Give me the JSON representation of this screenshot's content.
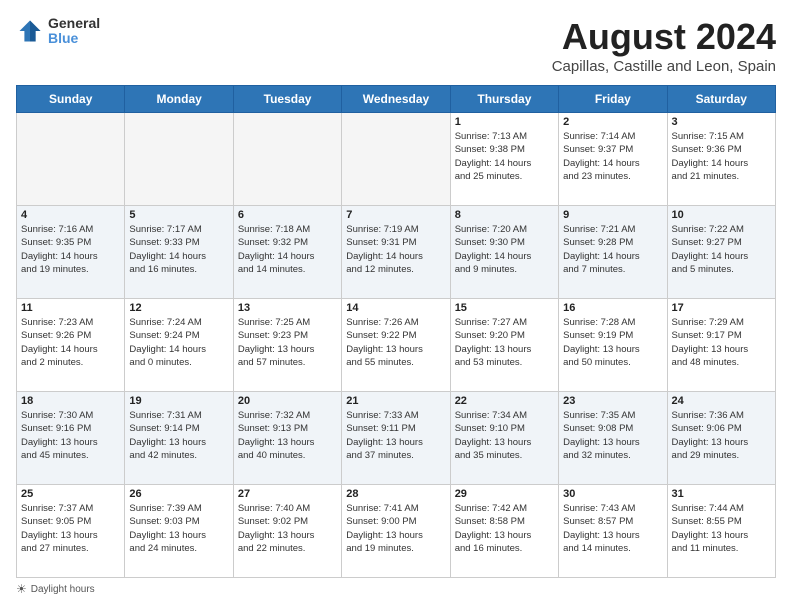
{
  "header": {
    "logo_line1": "General",
    "logo_line2": "Blue",
    "title": "August 2024",
    "subtitle": "Capillas, Castille and Leon, Spain"
  },
  "weekdays": [
    "Sunday",
    "Monday",
    "Tuesday",
    "Wednesday",
    "Thursday",
    "Friday",
    "Saturday"
  ],
  "footer": {
    "daylight_label": "Daylight hours"
  },
  "weeks": [
    [
      {
        "day": "",
        "info": ""
      },
      {
        "day": "",
        "info": ""
      },
      {
        "day": "",
        "info": ""
      },
      {
        "day": "",
        "info": ""
      },
      {
        "day": "1",
        "info": "Sunrise: 7:13 AM\nSunset: 9:38 PM\nDaylight: 14 hours\nand 25 minutes."
      },
      {
        "day": "2",
        "info": "Sunrise: 7:14 AM\nSunset: 9:37 PM\nDaylight: 14 hours\nand 23 minutes."
      },
      {
        "day": "3",
        "info": "Sunrise: 7:15 AM\nSunset: 9:36 PM\nDaylight: 14 hours\nand 21 minutes."
      }
    ],
    [
      {
        "day": "4",
        "info": "Sunrise: 7:16 AM\nSunset: 9:35 PM\nDaylight: 14 hours\nand 19 minutes."
      },
      {
        "day": "5",
        "info": "Sunrise: 7:17 AM\nSunset: 9:33 PM\nDaylight: 14 hours\nand 16 minutes."
      },
      {
        "day": "6",
        "info": "Sunrise: 7:18 AM\nSunset: 9:32 PM\nDaylight: 14 hours\nand 14 minutes."
      },
      {
        "day": "7",
        "info": "Sunrise: 7:19 AM\nSunset: 9:31 PM\nDaylight: 14 hours\nand 12 minutes."
      },
      {
        "day": "8",
        "info": "Sunrise: 7:20 AM\nSunset: 9:30 PM\nDaylight: 14 hours\nand 9 minutes."
      },
      {
        "day": "9",
        "info": "Sunrise: 7:21 AM\nSunset: 9:28 PM\nDaylight: 14 hours\nand 7 minutes."
      },
      {
        "day": "10",
        "info": "Sunrise: 7:22 AM\nSunset: 9:27 PM\nDaylight: 14 hours\nand 5 minutes."
      }
    ],
    [
      {
        "day": "11",
        "info": "Sunrise: 7:23 AM\nSunset: 9:26 PM\nDaylight: 14 hours\nand 2 minutes."
      },
      {
        "day": "12",
        "info": "Sunrise: 7:24 AM\nSunset: 9:24 PM\nDaylight: 14 hours\nand 0 minutes."
      },
      {
        "day": "13",
        "info": "Sunrise: 7:25 AM\nSunset: 9:23 PM\nDaylight: 13 hours\nand 57 minutes."
      },
      {
        "day": "14",
        "info": "Sunrise: 7:26 AM\nSunset: 9:22 PM\nDaylight: 13 hours\nand 55 minutes."
      },
      {
        "day": "15",
        "info": "Sunrise: 7:27 AM\nSunset: 9:20 PM\nDaylight: 13 hours\nand 53 minutes."
      },
      {
        "day": "16",
        "info": "Sunrise: 7:28 AM\nSunset: 9:19 PM\nDaylight: 13 hours\nand 50 minutes."
      },
      {
        "day": "17",
        "info": "Sunrise: 7:29 AM\nSunset: 9:17 PM\nDaylight: 13 hours\nand 48 minutes."
      }
    ],
    [
      {
        "day": "18",
        "info": "Sunrise: 7:30 AM\nSunset: 9:16 PM\nDaylight: 13 hours\nand 45 minutes."
      },
      {
        "day": "19",
        "info": "Sunrise: 7:31 AM\nSunset: 9:14 PM\nDaylight: 13 hours\nand 42 minutes."
      },
      {
        "day": "20",
        "info": "Sunrise: 7:32 AM\nSunset: 9:13 PM\nDaylight: 13 hours\nand 40 minutes."
      },
      {
        "day": "21",
        "info": "Sunrise: 7:33 AM\nSunset: 9:11 PM\nDaylight: 13 hours\nand 37 minutes."
      },
      {
        "day": "22",
        "info": "Sunrise: 7:34 AM\nSunset: 9:10 PM\nDaylight: 13 hours\nand 35 minutes."
      },
      {
        "day": "23",
        "info": "Sunrise: 7:35 AM\nSunset: 9:08 PM\nDaylight: 13 hours\nand 32 minutes."
      },
      {
        "day": "24",
        "info": "Sunrise: 7:36 AM\nSunset: 9:06 PM\nDaylight: 13 hours\nand 29 minutes."
      }
    ],
    [
      {
        "day": "25",
        "info": "Sunrise: 7:37 AM\nSunset: 9:05 PM\nDaylight: 13 hours\nand 27 minutes."
      },
      {
        "day": "26",
        "info": "Sunrise: 7:39 AM\nSunset: 9:03 PM\nDaylight: 13 hours\nand 24 minutes."
      },
      {
        "day": "27",
        "info": "Sunrise: 7:40 AM\nSunset: 9:02 PM\nDaylight: 13 hours\nand 22 minutes."
      },
      {
        "day": "28",
        "info": "Sunrise: 7:41 AM\nSunset: 9:00 PM\nDaylight: 13 hours\nand 19 minutes."
      },
      {
        "day": "29",
        "info": "Sunrise: 7:42 AM\nSunset: 8:58 PM\nDaylight: 13 hours\nand 16 minutes."
      },
      {
        "day": "30",
        "info": "Sunrise: 7:43 AM\nSunset: 8:57 PM\nDaylight: 13 hours\nand 14 minutes."
      },
      {
        "day": "31",
        "info": "Sunrise: 7:44 AM\nSunset: 8:55 PM\nDaylight: 13 hours\nand 11 minutes."
      }
    ]
  ]
}
